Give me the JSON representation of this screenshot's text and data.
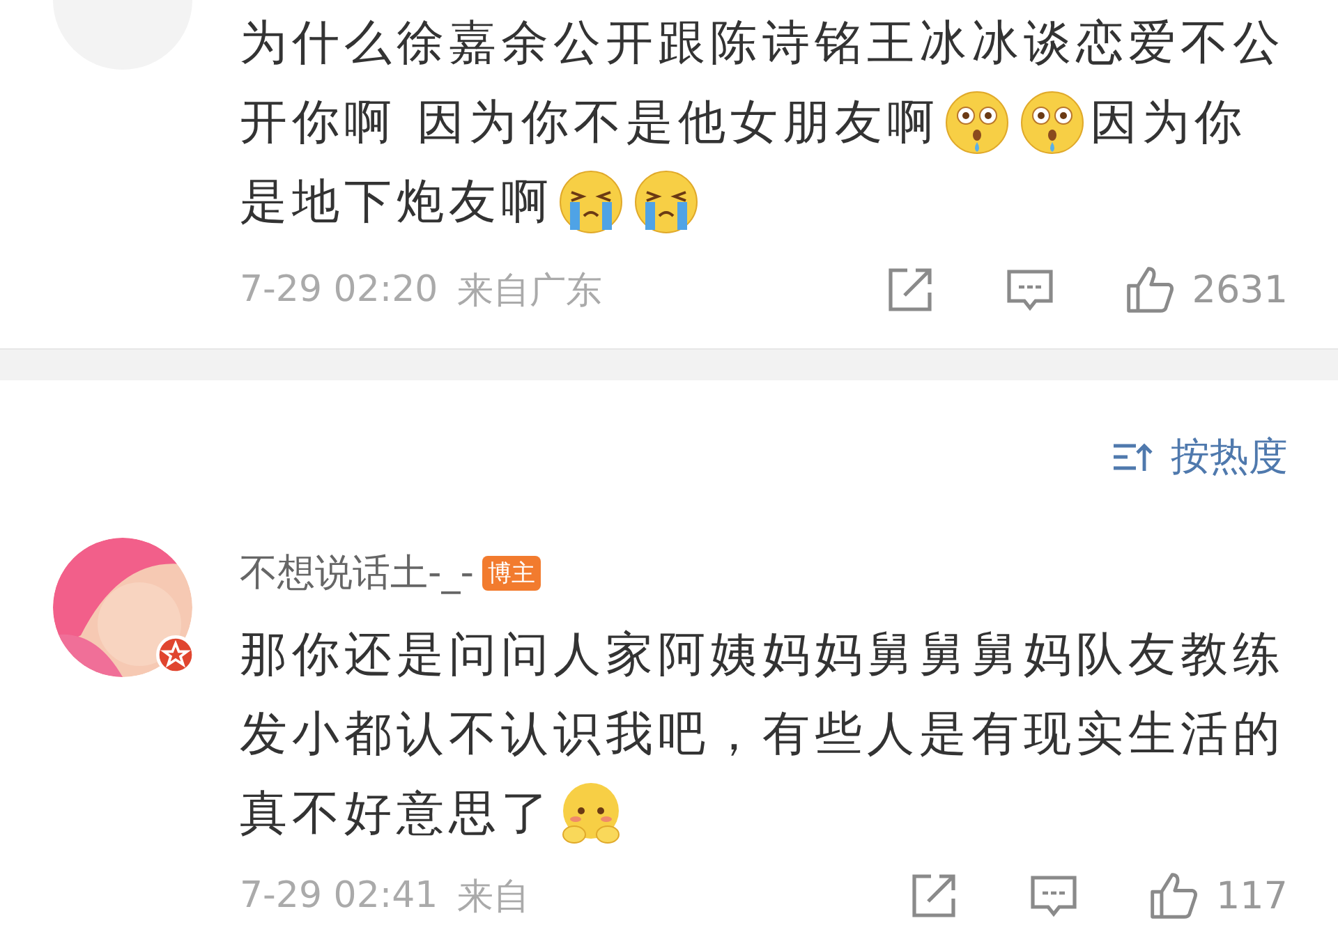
{
  "comments": [
    {
      "avatar": {
        "kind": "plain"
      },
      "verified": false,
      "lines": [
        [
          {
            "kind": "text",
            "text": "为什么徐嘉余公开跟陈诗铭王冰冰谈恋爱不公"
          }
        ],
        [
          {
            "kind": "text",
            "text": "开你啊 因为你不是他女朋友啊"
          },
          {
            "kind": "shocked"
          },
          {
            "kind": "shocked"
          },
          {
            "kind": "text",
            "text": "因为你"
          }
        ],
        [
          {
            "kind": "text",
            "text": "是地下炮友啊"
          },
          {
            "kind": "crying"
          },
          {
            "kind": "crying"
          }
        ]
      ],
      "time": "7-29 02:20",
      "location": "来自广东",
      "likes": "2631"
    },
    {
      "sort": {
        "label": "按热度"
      },
      "avatar": {
        "kind": "cartoon"
      },
      "verified": true,
      "username": "不想说话土-_-",
      "badge": "博主",
      "lines": [
        [
          {
            "kind": "text",
            "text": "那你还是问问人家阿姨妈妈舅舅舅妈队友教练"
          }
        ],
        [
          {
            "kind": "text",
            "text": "发小都认不认识我吧，有些人是有现实生活的"
          }
        ],
        [
          {
            "kind": "text",
            "text": "真不好意思了"
          },
          {
            "kind": "shy"
          }
        ]
      ],
      "time": "7-29 02:41",
      "location": "来自",
      "likes": "117"
    }
  ]
}
